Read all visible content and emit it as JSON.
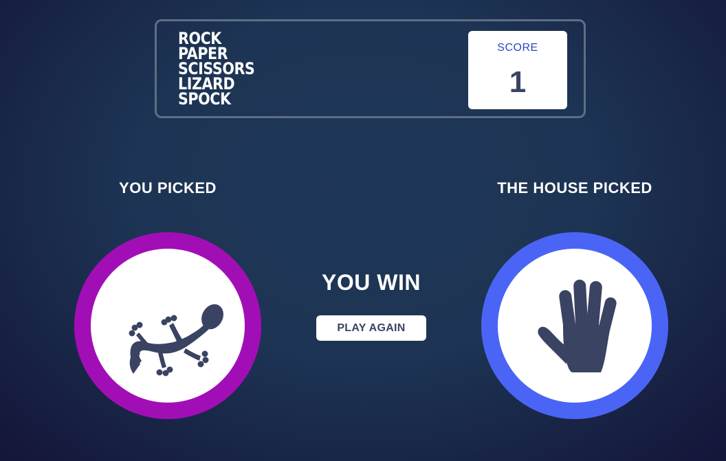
{
  "header": {
    "title_words": [
      "ROCK",
      "PAPER",
      "SCISSORS",
      "LIZARD",
      "SPOCK"
    ],
    "score_label": "SCORE",
    "score_value": "1"
  },
  "player": {
    "label": "YOU PICKED",
    "choice_icon": "lizard-icon",
    "ring_color": "#a20eb6"
  },
  "house": {
    "label": "THE HOUSE PICKED",
    "choice_icon": "spock-hand-icon",
    "ring_color": "#4a65f5"
  },
  "outcome": {
    "result_text": "YOU WIN",
    "play_again_label": "PLAY AGAIN"
  },
  "colors": {
    "icon": "#3b4363",
    "header_border": "#606e85",
    "score_label": "#2a45c2"
  }
}
